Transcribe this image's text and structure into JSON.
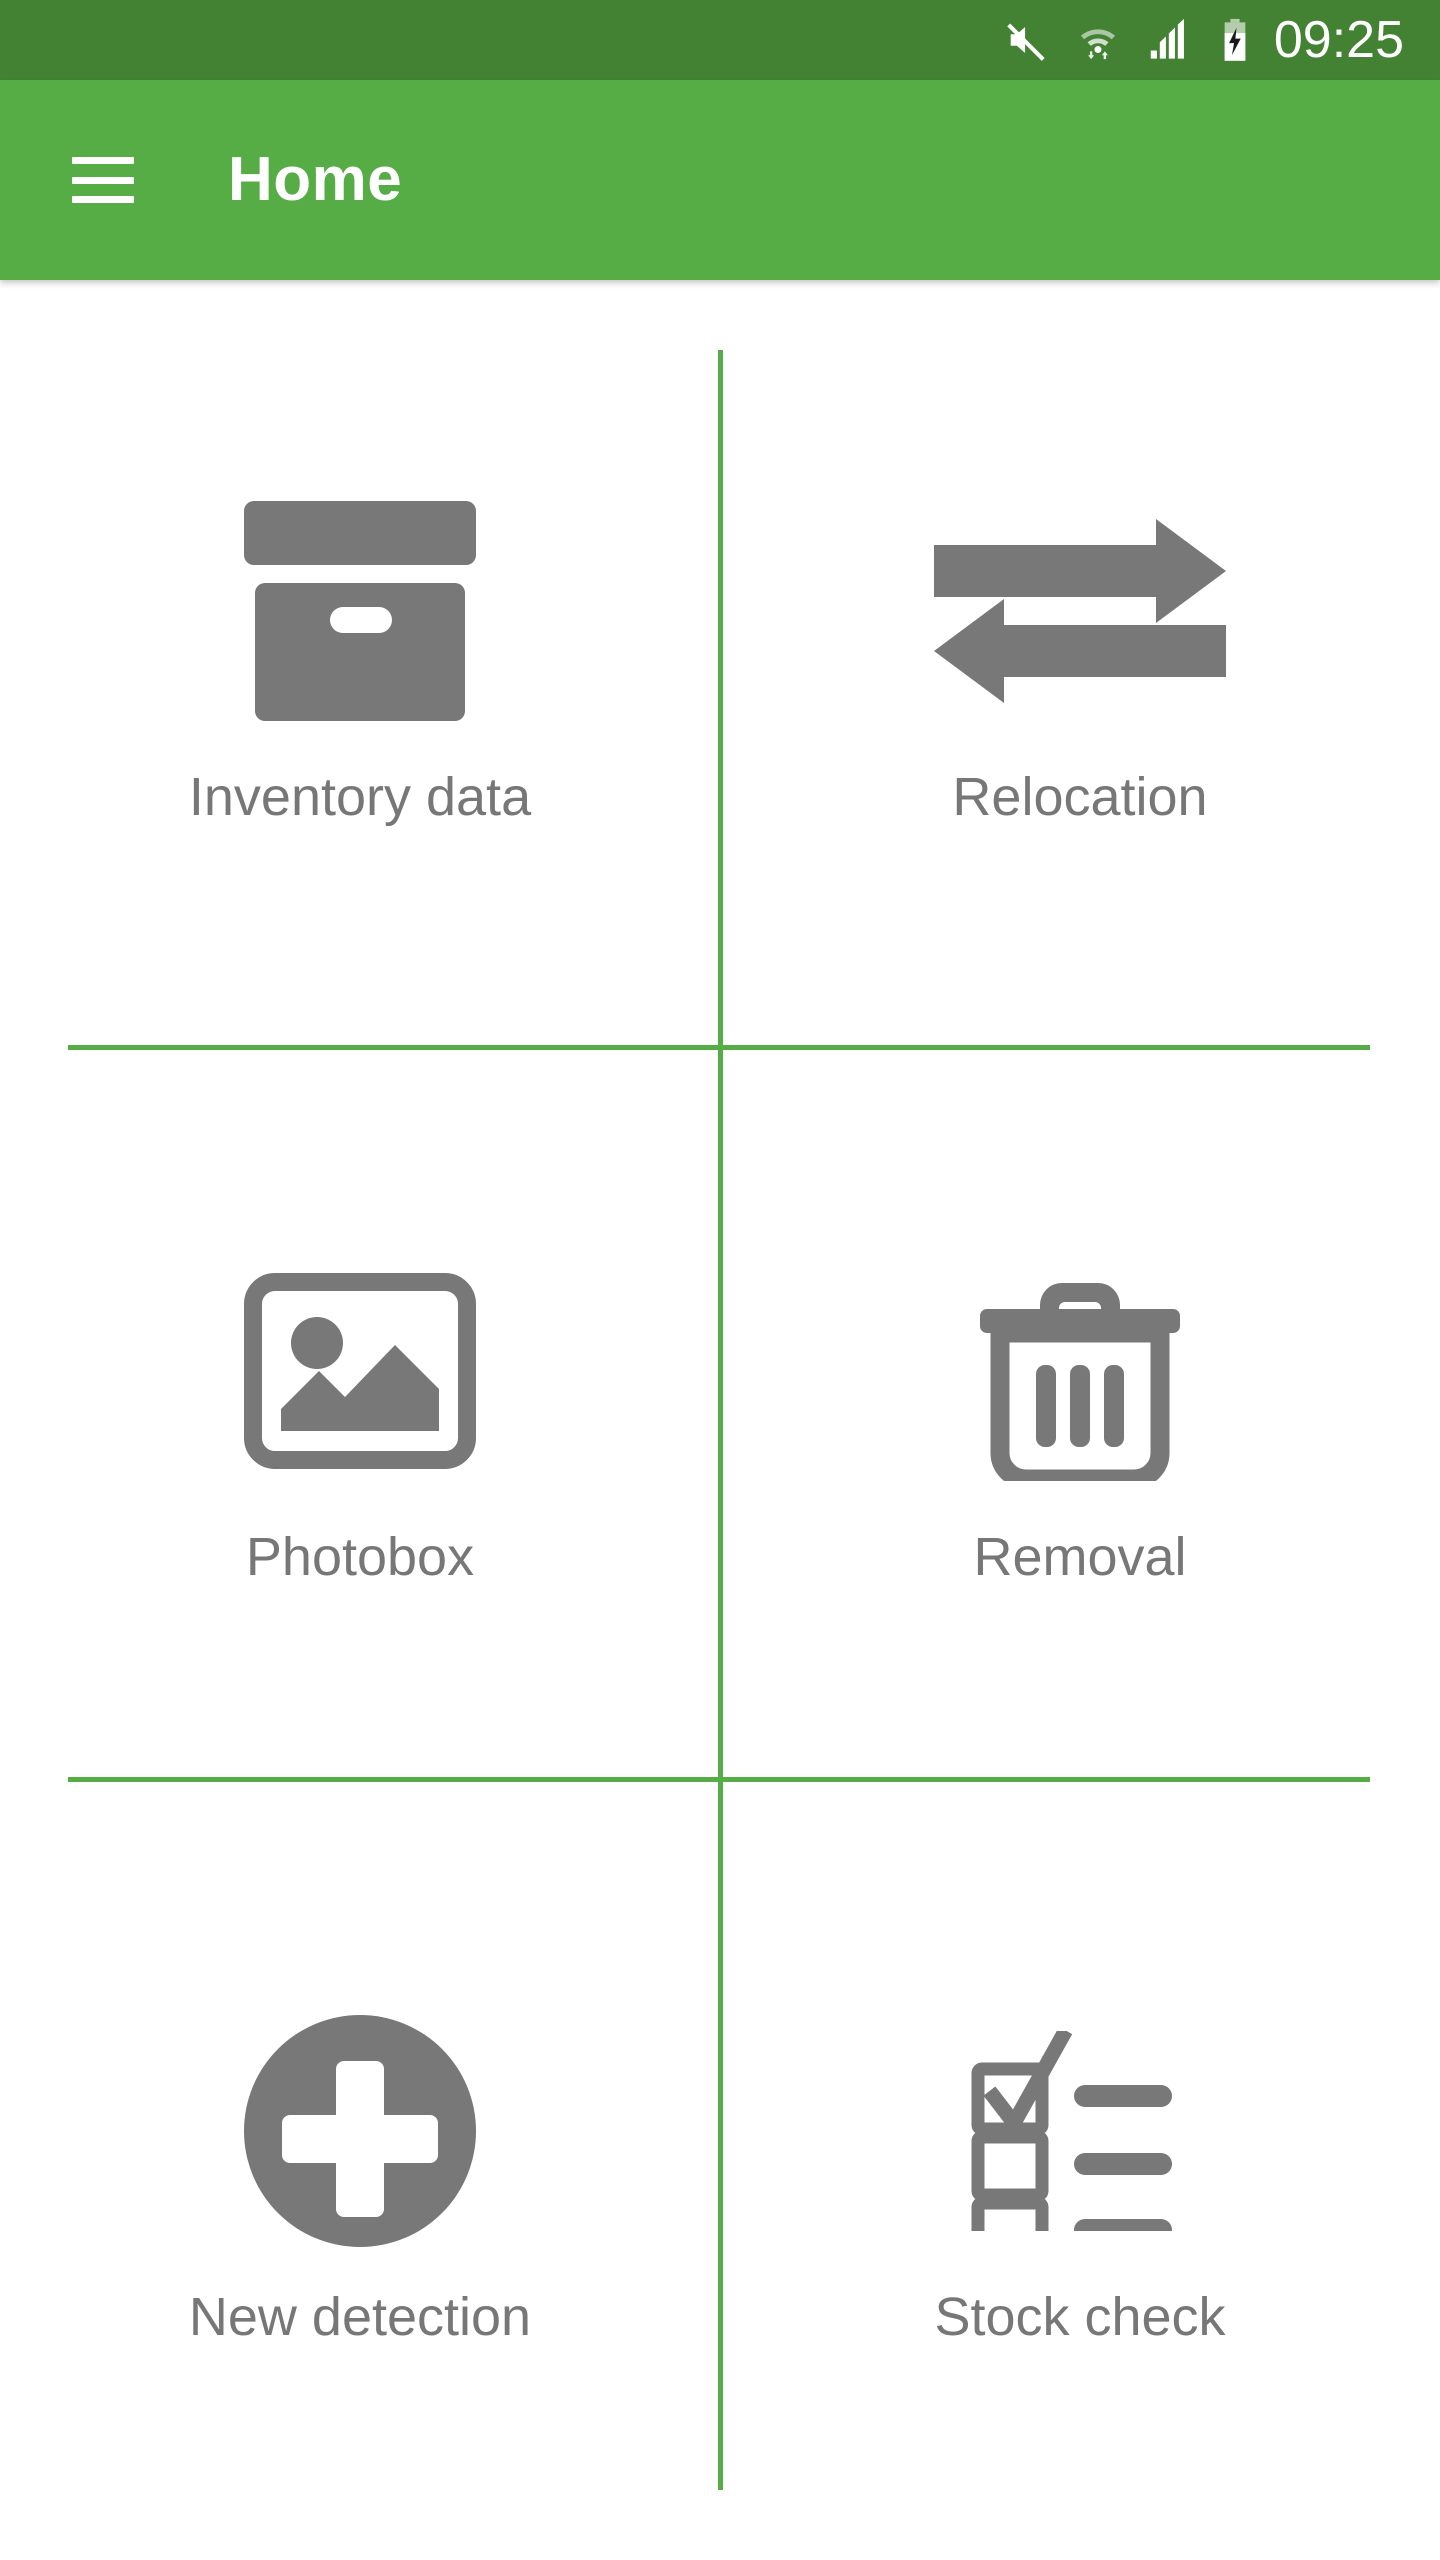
{
  "status_bar": {
    "time": "09:25",
    "icons": [
      {
        "name": "mute-icon",
        "label": "Silent mode"
      },
      {
        "name": "wifi-icon",
        "label": "Wi-Fi with data transfer"
      },
      {
        "name": "signal-icon",
        "label": "Cellular signal"
      },
      {
        "name": "battery-charging-icon",
        "label": "Battery charging"
      }
    ],
    "background_color": "#448233",
    "foreground_color": "#ffffff"
  },
  "app_bar": {
    "title": "Home",
    "menu_icon": "hamburger-menu-icon",
    "background_color": "#56ad45",
    "title_color": "#ffffff"
  },
  "theme": {
    "accent_color": "#56ad45",
    "divider_color": "#56ad45",
    "icon_color": "#787878",
    "label_color": "#777777",
    "page_background": "#ffffff"
  },
  "home_grid": {
    "columns": 2,
    "rows": 3,
    "items": [
      {
        "id": "inventory-data",
        "label": "Inventory data",
        "icon": "box-icon"
      },
      {
        "id": "relocation",
        "label": "Relocation",
        "icon": "transfer-arrows-icon"
      },
      {
        "id": "photobox",
        "label": "Photobox",
        "icon": "image-icon"
      },
      {
        "id": "removal",
        "label": "Removal",
        "icon": "trash-icon"
      },
      {
        "id": "new-detection",
        "label": "New detection",
        "icon": "plus-circle-icon"
      },
      {
        "id": "stock-check",
        "label": "Stock check",
        "icon": "checklist-icon"
      }
    ]
  }
}
